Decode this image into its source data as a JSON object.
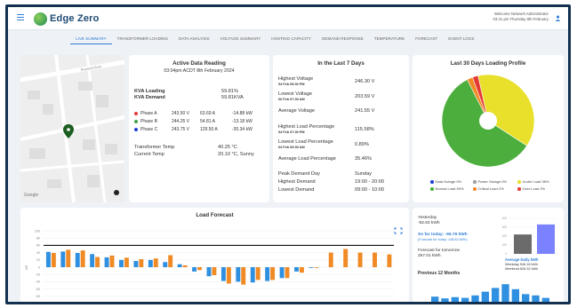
{
  "app": {
    "logo_text": "Edge Zero",
    "welcome_line1": "Welcome Network Administrator",
    "welcome_line2": "03:41 pm Thursday 8th February"
  },
  "tabs": [
    {
      "label": "LIVE SUMMARY",
      "active": true
    },
    {
      "label": "TRANSFORMER LOADING",
      "active": false
    },
    {
      "label": "DATA ANALYSIS",
      "active": false
    },
    {
      "label": "VOLTAGE SUMMARY",
      "active": false
    },
    {
      "label": "HOSTING CAPACITY",
      "active": false
    },
    {
      "label": "DEMAND RESPONSE",
      "active": false
    },
    {
      "label": "TEMPERATURE",
      "active": false
    },
    {
      "label": "FORECAST",
      "active": false
    },
    {
      "label": "EVENT LOGS",
      "active": false
    }
  ],
  "map": {
    "street_label": "Rowland Road",
    "watermark": "Google"
  },
  "active_reading": {
    "title": "Active Data Reading",
    "timestamp": "03:04pm ACDT 8th February 2024",
    "kva_loading_label": "KVA Loading",
    "kva_loading_value": "59.81%",
    "kva_demand_label": "KVA Demand",
    "kva_demand_value": "59.81KVA",
    "phases": [
      {
        "label": "Phase A",
        "voltage": "243.50 V",
        "kva": "63.69 A",
        "kw": "-14.88 kW",
        "color": "#e53935"
      },
      {
        "label": "Phase B",
        "voltage": "244.25 V",
        "kva": "54.81 A",
        "kw": "-13.18 kW",
        "color": "#43a047"
      },
      {
        "label": "Phase C",
        "voltage": "243.75 V",
        "kva": "129.50 A",
        "kw": "-30.34 kW",
        "color": "#1e3fd8"
      }
    ],
    "transformer_temp_label": "Transformer Temp",
    "transformer_temp_value": "40.25 °C",
    "current_temp_label": "Current Temp",
    "current_temp_value": "20.10 °C, Sunny"
  },
  "last7": {
    "title": "In the Last 7 Days",
    "highest_voltage_label": "Highest Voltage",
    "highest_voltage_sub": "04 Feb 09:00 PM",
    "highest_voltage_value": "246.30 V",
    "lowest_voltage_label": "Lowest Voltage",
    "lowest_voltage_sub": "06 Feb 07:00 AM",
    "lowest_voltage_value": "203.59 V",
    "avg_voltage_label": "Average Voltage",
    "avg_voltage_value": "241.55 V",
    "highest_load_label": "Highest Load Percentage",
    "highest_load_sub": "04 Feb 07:00 PM",
    "highest_load_value": "115.58%",
    "lowest_load_label": "Lowest Load Percentage",
    "lowest_load_sub": "04 Feb 09:00 AM",
    "lowest_load_value": "0.89%",
    "avg_load_label": "Average Load Percentage",
    "avg_load_value": "35.46%",
    "peak_day_label": "Peak Demand Day",
    "peak_day_value": "Sunday",
    "highest_demand_label": "Highest Demand",
    "highest_demand_value": "19:00 - 20:00",
    "lowest_demand_label": "Lowest Demand",
    "lowest_demand_value": "09:00 - 10:00"
  },
  "loading_profile": {
    "title": "Last 30 Days Loading Profile",
    "legend": [
      {
        "label": "Data Outage",
        "value": "0%",
        "color": "#1e3fd8"
      },
      {
        "label": "Power Outage",
        "value": "0%",
        "color": "#9e9e9e"
      },
      {
        "label": "Under Load",
        "value": "38%",
        "color": "#e8e02a"
      },
      {
        "label": "Normal Load",
        "value": "59%",
        "color": "#4cae3c"
      },
      {
        "label": "Critical Load",
        "value": "2%",
        "color": "#f08a24"
      },
      {
        "label": "Over Load",
        "value": "2%",
        "color": "#e53935"
      }
    ]
  },
  "forecast": {
    "title": "Load Forecast",
    "ylabel": "kW",
    "y_ticks": [
      "100",
      "80",
      "60",
      "40",
      "20",
      "0",
      "-20",
      "-40",
      "-60",
      "-80",
      "-100"
    ],
    "threshold": 60
  },
  "summary": {
    "yesterday_label": "Yesterday",
    "yesterday_value": "-92.63 kWh",
    "so_far_label": "So far today: -65.76 kWh",
    "so_far_sub": "(Forecast for today: 148.82 kWh)",
    "forecast_label": "Forecast for tomorrow",
    "forecast_value": "257.01 kWh",
    "avg_daily_label": "Average Daily kWh",
    "weekday_label": "Weekday 546.18 kWh",
    "weekend_label": "Weekend 828.32 kWh",
    "prev12_label": "Previous 12 Months",
    "avg_ticks": [
      "400",
      "300",
      "200",
      "100",
      "0"
    ]
  },
  "chart_data": [
    {
      "type": "pie",
      "title": "Last 30 Days Loading Profile",
      "categories": [
        "Data Outage",
        "Power Outage",
        "Under Load",
        "Normal Load",
        "Critical Load",
        "Over Load"
      ],
      "values": [
        0,
        0,
        38,
        59,
        2,
        2
      ],
      "colors": [
        "#1e3fd8",
        "#9e9e9e",
        "#e8e02a",
        "#4cae3c",
        "#f08a24",
        "#e53935"
      ],
      "legend": "bottom"
    },
    {
      "type": "bar",
      "title": "Load Forecast",
      "ylabel": "kW",
      "ylim": [
        -100,
        100
      ],
      "threshold": 60,
      "series": [
        {
          "values": [
            42,
            43,
            39,
            36,
            27,
            20,
            17,
            20,
            14,
            8,
            -12,
            -25,
            -38,
            -40,
            -42,
            -38,
            -30,
            -12,
            -2,
            null,
            null,
            null,
            null,
            null
          ],
          "color": "#2f8fe0"
        },
        {
          "values": [
            39,
            48,
            46,
            28,
            32,
            26,
            22,
            24,
            33,
            5,
            -8,
            -22,
            -45,
            -48,
            -35,
            -35,
            -30,
            -15,
            -2,
            40,
            50,
            40,
            40,
            35
          ],
          "color": "#f08a24"
        }
      ]
    },
    {
      "type": "bar",
      "title": "Average Daily kWh",
      "categories": [
        "Weekday",
        "Weekend"
      ],
      "values": [
        546.18,
        828.32
      ],
      "colors": [
        "#6b6b6b",
        "#7b82ff"
      ]
    },
    {
      "type": "bar",
      "title": "Previous 12 Months",
      "values": [
        35,
        28,
        33,
        30,
        40,
        55,
        70,
        85,
        65,
        45,
        40,
        30
      ],
      "color": "#2f8fe0"
    }
  ]
}
